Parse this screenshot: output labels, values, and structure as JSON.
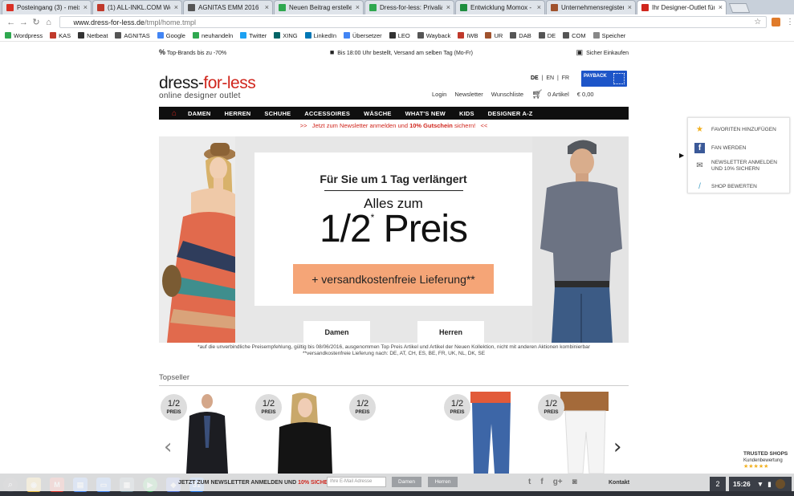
{
  "browser": {
    "tabs": [
      {
        "title": "Posteingang (3) - meix",
        "favicon": "gmail-icon",
        "color": "#d93025"
      },
      {
        "title": "(1) ALL-INKL.COM Webm",
        "favicon": "allinkl-icon",
        "color": "#c0392b"
      },
      {
        "title": "AGNITAS EMM 2016",
        "favicon": "agnitas-icon",
        "color": "#555555"
      },
      {
        "title": "Neuen Beitrag erstellen",
        "favicon": "neuhandeln-icon",
        "color": "#2fa84f"
      },
      {
        "title": "Dress-for-less: Privalia",
        "favicon": "neuhandeln-icon",
        "color": "#2fa84f"
      },
      {
        "title": "Entwicklung Momox - Go",
        "favicon": "sheets-icon",
        "color": "#1e8e3e"
      },
      {
        "title": "Unternehmensregister",
        "favicon": "register-icon",
        "color": "#a0522d"
      },
      {
        "title": "Ihr Designer-Outlet für M",
        "favicon": "dfl-icon",
        "color": "#d0261d"
      }
    ],
    "url_host": "www.dress-for-less.de",
    "url_path": "/tmpl/home.tmpl",
    "bookmarks": [
      {
        "label": "Wordpress",
        "color": "#2fa84f"
      },
      {
        "label": "KAS",
        "color": "#c0392b"
      },
      {
        "label": "Netbeat",
        "color": "#333333"
      },
      {
        "label": "AGNITAS",
        "color": "#555555"
      },
      {
        "label": "Google",
        "color": "#4285f4"
      },
      {
        "label": "neuhandeln",
        "color": "#2fa84f"
      },
      {
        "label": "Twitter",
        "color": "#1da1f2"
      },
      {
        "label": "XING",
        "color": "#026466"
      },
      {
        "label": "LinkedIn",
        "color": "#0077b5"
      },
      {
        "label": "Übersetzer",
        "color": "#4285f4"
      },
      {
        "label": "LEO",
        "color": "#333333"
      },
      {
        "label": "Wayback",
        "color": "#555555"
      },
      {
        "label": "IWB",
        "color": "#c0392b"
      },
      {
        "label": "UR",
        "color": "#a0522d"
      },
      {
        "label": "DAB",
        "color": "#555555"
      },
      {
        "label": "DE",
        "color": "#555555"
      },
      {
        "label": "COM",
        "color": "#555555"
      },
      {
        "label": "Speicher",
        "color": "#888888"
      }
    ]
  },
  "site": {
    "usp_left": "Top-Brands bis zu -70%",
    "usp_mid": "Bis 18:00 Uhr bestellt, Versand am selben Tag (Mo-Fr)",
    "usp_right": "Sicher Einkaufen",
    "logo_a": "dress-",
    "logo_b": "for-less",
    "logo_sub": "online designer outlet",
    "lang_de": "DE",
    "lang_en": "EN",
    "lang_fr": "FR",
    "payback": "PAYBACK",
    "login": "Login",
    "newsletter": "Newsletter",
    "wishlist": "Wunschliste",
    "cart_count": "0 Artikel",
    "cart_total": "€ 0,00",
    "menu": [
      "DAMEN",
      "HERREN",
      "SCHUHE",
      "ACCESSOIRES",
      "WÄSCHE",
      "WHAT'S NEW",
      "KIDS",
      "DESIGNER A-Z"
    ],
    "promo_arrows_left": ">>",
    "promo_text": "Jetzt zum Newsletter anmelden und ",
    "promo_bold": "10% Gutschein",
    "promo_tail": " sichern!",
    "promo_arrows_right": "<<",
    "hero": {
      "line1": "Für Sie um 1 Tag verlängert",
      "line2": "Alles zum",
      "big_a": "1/2",
      "big_star": "*",
      "big_b": " Preis",
      "cta": "+ versandkostenfreie Lieferung**",
      "btn_women": "Damen",
      "btn_men": "Herren"
    },
    "footnote1": "*auf die unverbindliche Preisempfehlung, gültig bis 08/06/2016, ausgenommen Top Preis Artikel und Artikel der Neuen Kollektion, nicht mit anderen Aktionen kombinierbar",
    "footnote2": "**versandkostenfreie Lieferung nach: DE, AT, CH, ES, BE, FR, UK, NL, DK, SE",
    "topseller": "Topseller",
    "badge_top": "1/2",
    "badge_bottom": "PREIS",
    "side_panel": [
      {
        "label": "FAVORITEN HINZUFÜGEN",
        "icon": "star-icon"
      },
      {
        "label": "FAN WERDEN",
        "icon": "facebook-icon"
      },
      {
        "label": "NEWSLETTER ANMELDEN UND 10% SICHERN",
        "icon": "mail-icon"
      },
      {
        "label": "SHOP BEWERTEN",
        "icon": "pen-icon"
      }
    ],
    "trusted_title": "TRUSTED SHOPS",
    "trusted_sub": "Kundenbewertung",
    "newsletter_bar": {
      "text_a": "JETZT ZUM NEWSLETTER ANMELDEN UND ",
      "text_red": "10% SICHERN!",
      "placeholder": "Ihre E-Mail Adresse",
      "btn_women": "Damen",
      "btn_men": "Herren",
      "kontakt": "Kontakt"
    }
  },
  "taskbar": {
    "badge": "31",
    "windows": "2",
    "time": "15:26"
  }
}
